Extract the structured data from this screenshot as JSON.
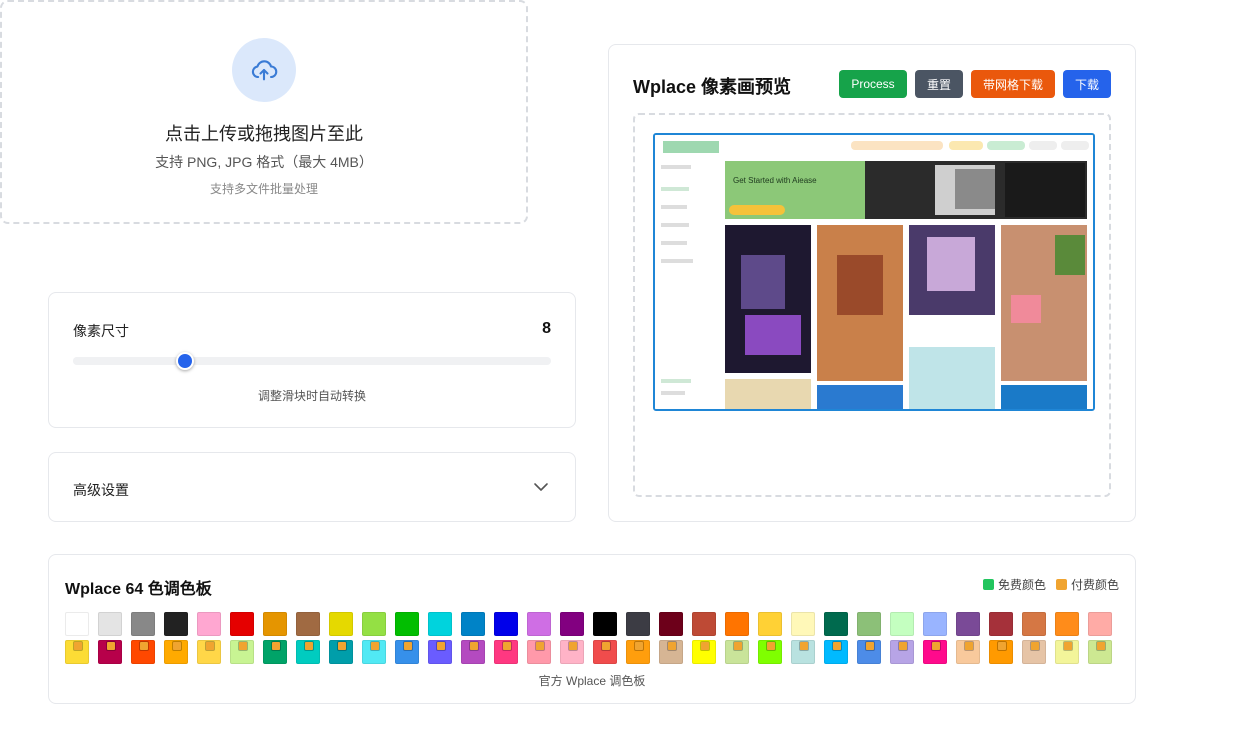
{
  "upload": {
    "title": "点击上传或拖拽图片至此",
    "formats": "支持 PNG, JPG 格式（最大 4MB）",
    "batch": "支持多文件批量处理",
    "icon": "cloud-upload-icon"
  },
  "pixel": {
    "label": "像素尺寸",
    "value": "8",
    "slider_fraction": 0.235,
    "hint": "调整滑块时自动转换"
  },
  "advanced": {
    "label": "高级设置",
    "icon": "chevron-down-icon"
  },
  "preview": {
    "title": "Wplace 像素画预览",
    "process_label": "Process",
    "reset_label": "重置",
    "grid_download_label": "带网格下载",
    "download_label": "下载",
    "image_text": "Get Started with Aiease"
  },
  "palette": {
    "title": "Wplace 64 色调色板",
    "free_label": "免费颜色",
    "paid_label": "付费颜色",
    "free_color": "#22c55e",
    "paid_color": "#f0a430",
    "footer": "官方 Wplace 调色板",
    "row1": [
      "#ffffff",
      "#e4e4e4",
      "#888888",
      "#222222",
      "#ffa7d1",
      "#e50000",
      "#e59500",
      "#a06a42",
      "#e5d900",
      "#94e044",
      "#02be01",
      "#00d3dd",
      "#0083c7",
      "#0000ea",
      "#cf6ee4",
      "#820080",
      "#000000",
      "#3c3c44",
      "#6d001a",
      "#be4a35",
      "#ff7400",
      "#ffd135",
      "#fff8b8",
      "#006a4e",
      "#8cc078",
      "#c4ffc0",
      "#99b4ff",
      "#7a4a97",
      "#a5313a",
      "#d57744",
      "#ff8c1a",
      "#ffaba6"
    ],
    "row2": [
      "#fcdc35",
      "#b7004a",
      "#ff4800",
      "#ffaa00",
      "#ffd748",
      "#c8f493",
      "#00a368",
      "#00ccc0",
      "#009eaa",
      "#51e9f4",
      "#3690ea",
      "#6a5cff",
      "#b44ac0",
      "#ff3881",
      "#ff99aa",
      "#ffb3c7",
      "#f04c4c",
      "#ff9e0d",
      "#d6b594",
      "#ffff00",
      "#c9e49a",
      "#7fff00",
      "#b9e2e0",
      "#00baff",
      "#4d8ce8",
      "#b7a4e6",
      "#ff0a8c",
      "#f8c99c",
      "#ff9a00",
      "#e6c4a6",
      "#f3f59a",
      "#cde892"
    ]
  }
}
